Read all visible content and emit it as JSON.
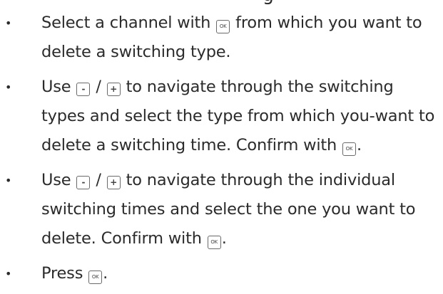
{
  "heading_fragment": "g",
  "bullet_glyph": "•",
  "keys": {
    "ok": "OK",
    "minus": "-",
    "plus": "+"
  },
  "steps": [
    {
      "a": "Select a channel with ",
      "b": " from which you want to delete a switching type."
    },
    {
      "a": "Use ",
      "sep": " / ",
      "b": " to navigate through the switching types and select the type from which you-want to delete a switching time. Confirm with ",
      "c": "."
    },
    {
      "a": "Use ",
      "sep": " / ",
      "b": " to navigate through the individual switching times and select the one you want to delete. Confirm with ",
      "c": "."
    },
    {
      "a": "Press ",
      "c": "."
    }
  ]
}
